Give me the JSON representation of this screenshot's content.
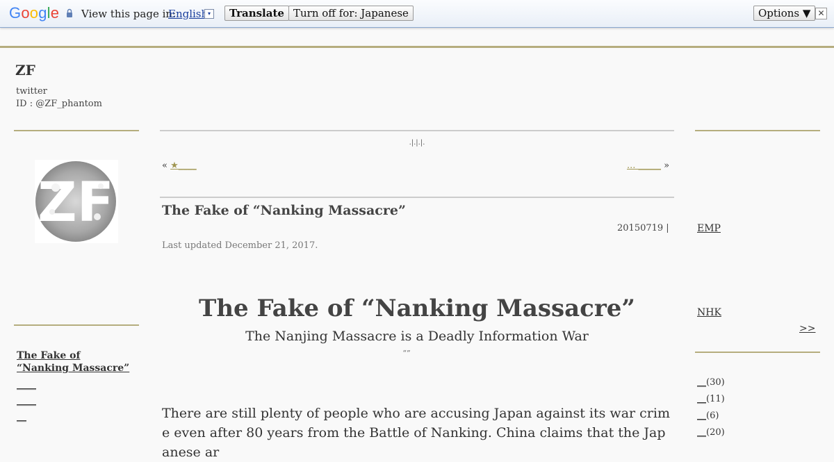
{
  "translate_bar": {
    "logo": [
      "G",
      "o",
      "o",
      "g",
      "l",
      "e"
    ],
    "view_label": "View this page in:",
    "language": "English",
    "dropdown_glyph": "▾",
    "translate_label": "Translate",
    "turn_off_label": "Turn off for: Japanese",
    "options_label": "Options ▼",
    "close_glyph": "✕"
  },
  "site": {
    "title": "ZF",
    "line1": "twitter",
    "line2": "ID : @ZF_phantom",
    "avatar_text": "ZF"
  },
  "left_nav": {
    "item1": "The Fake of “Nanking Massacre”",
    "item2": "____",
    "item3": "____",
    "item4": "__"
  },
  "main": {
    "breadcrumb": ".|.|.|.",
    "prev_arrow": "«",
    "prev_link": "★____",
    "next_link": "... _____",
    "next_arrow": "»",
    "post_title": "The Fake of “Nanking Massacre”",
    "post_meta": "20150719 |",
    "updated": "Last updated December 21, 2017.",
    "big_title": "The Fake of “Nanking Massacre”",
    "big_subtitle": "The Nanjing Massacre is a Deadly Information War",
    "quotes": "“”",
    "body": "There are still plenty of people who are accusing Japan against its war crime even after 80 years from the Battle of Nanking. China claims that the Japanese ar"
  },
  "right_nav": {
    "emp": "EMP",
    "nhk": "NHK",
    "more": ">> ",
    "categories": [
      {
        "label": "__",
        "count": "(30)"
      },
      {
        "label": "__",
        "count": "(11)"
      },
      {
        "label": "__",
        "count": "(6)"
      },
      {
        "label": "__",
        "count": "(20)"
      }
    ]
  },
  "colors": {
    "accent_rule": "#b5ad7e",
    "link_gold": "#a09652",
    "bar_border": "#8aa7cf"
  }
}
